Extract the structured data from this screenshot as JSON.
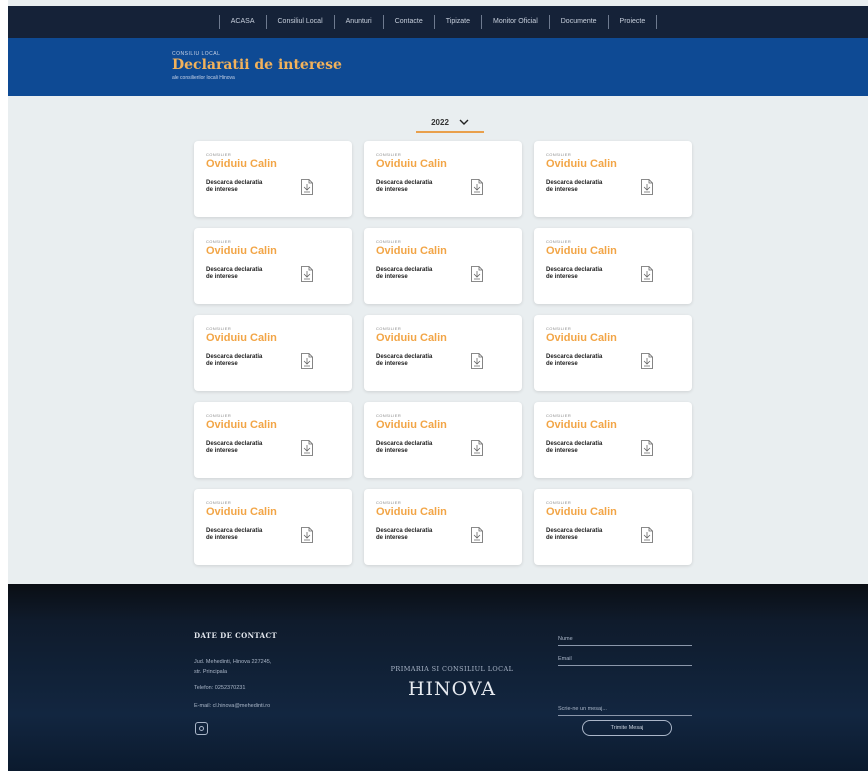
{
  "nav": {
    "items": [
      "ACASA",
      "Consiliul Local",
      "Anunturi",
      "Contacte",
      "Tipizate",
      "Monitor Oficial",
      "Documente",
      "Proiecte"
    ]
  },
  "banner": {
    "kicker": "CONSILIU LOCAL",
    "title": "Declaratii de interese",
    "subtitle": "ale consilierilor locali Hinova"
  },
  "year_select": {
    "value": "2022"
  },
  "card_common": {
    "role": "CONSILIER",
    "name": "Oviduiu Calin",
    "download_label": "Descarca declaratia de interese"
  },
  "cards": [
    {
      "role": "CONSILIER",
      "name": "Oviduiu Calin",
      "download": "Descarca declaratia de interese"
    },
    {
      "role": "CONSILIER",
      "name": "Oviduiu Calin",
      "download": "Descarca declaratia de interese"
    },
    {
      "role": "CONSILIER",
      "name": "Oviduiu Calin",
      "download": "Descarca declaratia de interese"
    },
    {
      "role": "CONSILIER",
      "name": "Oviduiu Calin",
      "download": "Descarca declaratia de interese"
    },
    {
      "role": "CONSILIER",
      "name": "Oviduiu Calin",
      "download": "Descarca declaratia de interese"
    },
    {
      "role": "CONSILIER",
      "name": "Oviduiu Calin",
      "download": "Descarca declaratia de interese"
    },
    {
      "role": "CONSILIER",
      "name": "Oviduiu Calin",
      "download": "Descarca declaratia de interese"
    },
    {
      "role": "CONSILIER",
      "name": "Oviduiu Calin",
      "download": "Descarca declaratia de interese"
    },
    {
      "role": "CONSILIER",
      "name": "Oviduiu Calin",
      "download": "Descarca declaratia de interese"
    },
    {
      "role": "CONSILIER",
      "name": "Oviduiu Calin",
      "download": "Descarca declaratia de interese"
    },
    {
      "role": "CONSILIER",
      "name": "Oviduiu Calin",
      "download": "Descarca declaratia de interese"
    },
    {
      "role": "CONSILIER",
      "name": "Oviduiu Calin",
      "download": "Descarca declaratia de interese"
    },
    {
      "role": "CONSILIER",
      "name": "Oviduiu Calin",
      "download": "Descarca declaratia de interese"
    },
    {
      "role": "CONSILIER",
      "name": "Oviduiu Calin",
      "download": "Descarca declaratia de interese"
    },
    {
      "role": "CONSILIER",
      "name": "Oviduiu Calin",
      "download": "Descarca declaratia de interese"
    }
  ],
  "footer": {
    "contact_heading": "DATE DE CONTACT",
    "address_line1": "Jud. Mehedinti, Hinova 227245,",
    "address_line2": "str. Principala",
    "phone": "Telefon: 0252370231",
    "email": "E-mail: cl.hinova@mehedinti.ro",
    "center_sub": "PRIMARIA SI CONSILIUL LOCAL",
    "center_main": "HINOVA",
    "form_name": "Nume",
    "form_email": "Email",
    "form_message": "Scrie-ne un mesaj...",
    "send_label": "Trimite Mesaj"
  },
  "colors": {
    "nav_bg": "#152238",
    "banner_bg": "#0e4a94",
    "accent": "#f2a546",
    "footer_bg": "#122640"
  }
}
